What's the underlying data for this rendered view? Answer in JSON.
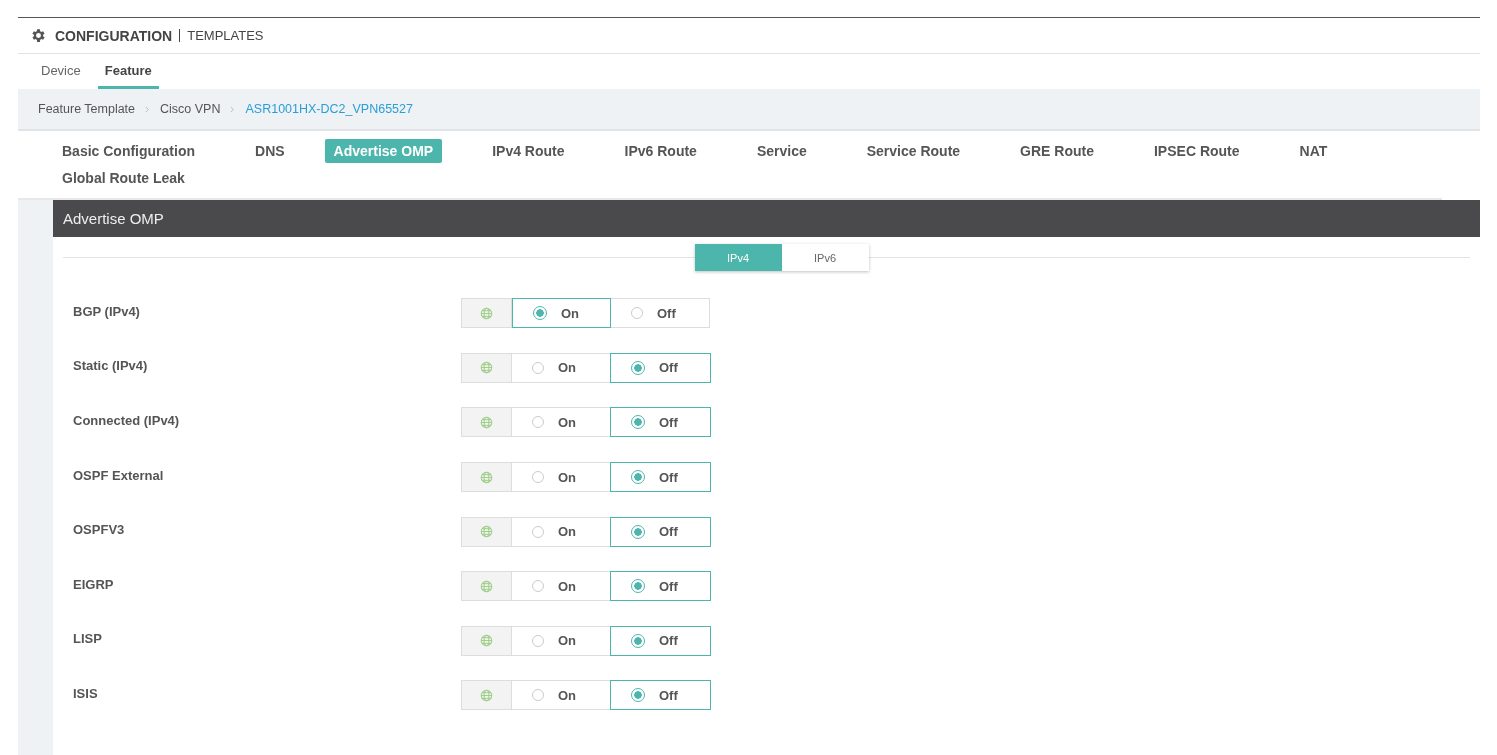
{
  "header": {
    "title": "CONFIGURATION",
    "subtitle": "TEMPLATES"
  },
  "tabs": [
    {
      "label": "Device",
      "selected": false
    },
    {
      "label": "Feature",
      "selected": true
    }
  ],
  "breadcrumb": [
    {
      "label": "Feature Template",
      "kind": "text"
    },
    {
      "label": "Cisco VPN",
      "kind": "text"
    },
    {
      "label": "ASR1001HX-DC2_VPN65527",
      "kind": "link"
    }
  ],
  "section_nav": [
    {
      "label": "Basic Configuration",
      "selected": false
    },
    {
      "label": "DNS",
      "selected": false
    },
    {
      "label": "Advertise OMP",
      "selected": true
    },
    {
      "label": "IPv4 Route",
      "selected": false
    },
    {
      "label": "IPv6 Route",
      "selected": false
    },
    {
      "label": "Service",
      "selected": false
    },
    {
      "label": "Service Route",
      "selected": false
    },
    {
      "label": "GRE Route",
      "selected": false
    },
    {
      "label": "IPSEC Route",
      "selected": false
    },
    {
      "label": "NAT",
      "selected": false
    },
    {
      "label": "Global Route Leak",
      "selected": false
    }
  ],
  "panel": {
    "title": "Advertise OMP",
    "segments": [
      {
        "label": "IPv4",
        "selected": true
      },
      {
        "label": "IPv6",
        "selected": false
      }
    ],
    "rows": [
      {
        "label": "BGP (IPv4)",
        "options": [
          {
            "label": "On",
            "selected": true
          },
          {
            "label": "Off",
            "selected": false
          }
        ]
      },
      {
        "label": "Static (IPv4)",
        "options": [
          {
            "label": "On",
            "selected": false
          },
          {
            "label": "Off",
            "selected": true
          }
        ]
      },
      {
        "label": "Connected (IPv4)",
        "options": [
          {
            "label": "On",
            "selected": false
          },
          {
            "label": "Off",
            "selected": true
          }
        ]
      },
      {
        "label": "OSPF External",
        "options": [
          {
            "label": "On",
            "selected": false
          },
          {
            "label": "Off",
            "selected": true
          }
        ]
      },
      {
        "label": "OSPFV3",
        "options": [
          {
            "label": "On",
            "selected": false
          },
          {
            "label": "Off",
            "selected": true
          }
        ]
      },
      {
        "label": "EIGRP",
        "options": [
          {
            "label": "On",
            "selected": false
          },
          {
            "label": "Off",
            "selected": true
          }
        ]
      },
      {
        "label": "LISP",
        "options": [
          {
            "label": "On",
            "selected": false
          },
          {
            "label": "Off",
            "selected": true
          }
        ]
      },
      {
        "label": "ISIS",
        "options": [
          {
            "label": "On",
            "selected": false
          },
          {
            "label": "Off",
            "selected": true
          }
        ]
      }
    ]
  }
}
